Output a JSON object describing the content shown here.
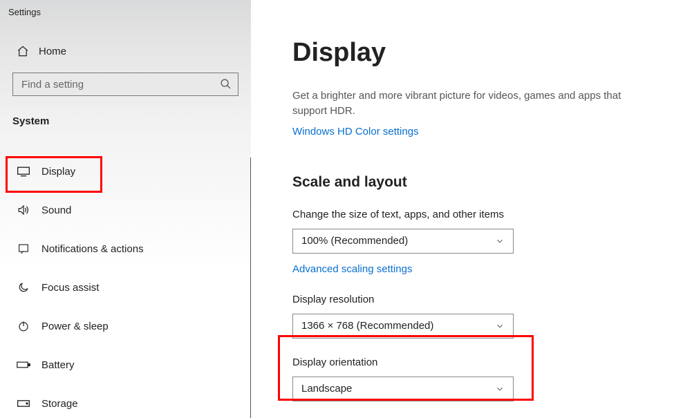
{
  "app_title": "Settings",
  "home_label": "Home",
  "search": {
    "placeholder": "Find a setting"
  },
  "section": "System",
  "nav": {
    "items": [
      {
        "label": "Display"
      },
      {
        "label": "Sound"
      },
      {
        "label": "Notifications & actions"
      },
      {
        "label": "Focus assist"
      },
      {
        "label": "Power & sleep"
      },
      {
        "label": "Battery"
      },
      {
        "label": "Storage"
      }
    ]
  },
  "main": {
    "title": "Display",
    "hdr_desc": "Get a brighter and more vibrant picture for videos, games and apps that support HDR.",
    "hdr_link": "Windows HD Color settings",
    "scale_heading": "Scale and layout",
    "scale_label": "Change the size of text, apps, and other items",
    "scale_value": "100% (Recommended)",
    "adv_scaling": "Advanced scaling settings",
    "resolution_label": "Display resolution",
    "resolution_value": "1366 × 768 (Recommended)",
    "orientation_label": "Display orientation",
    "orientation_value": "Landscape"
  }
}
